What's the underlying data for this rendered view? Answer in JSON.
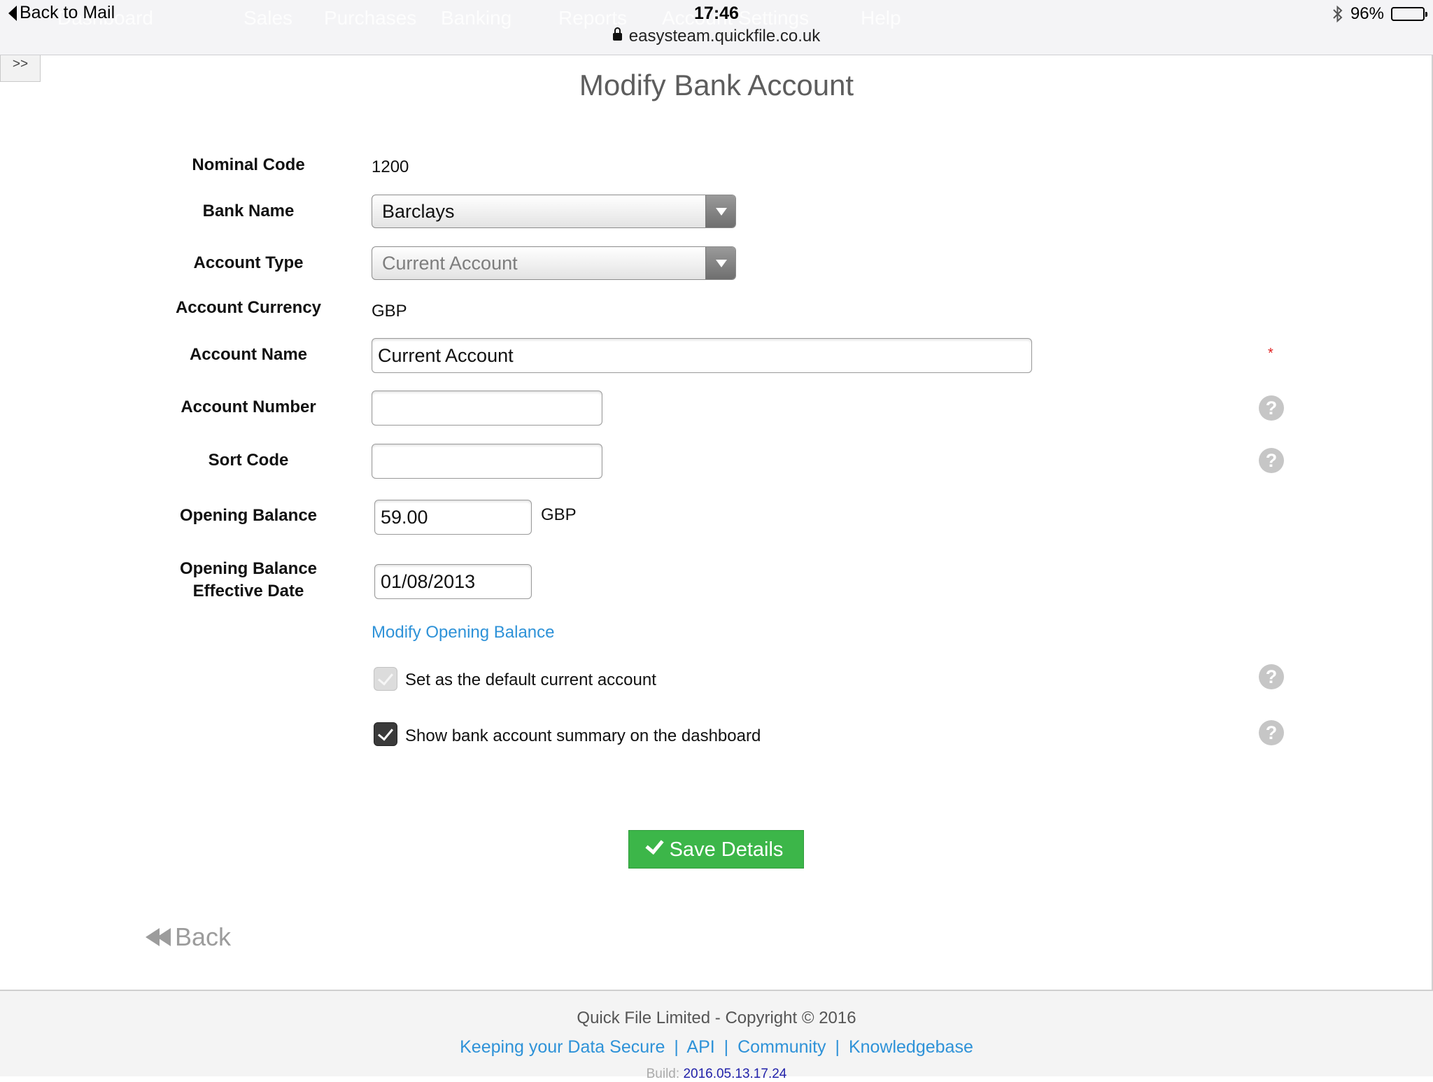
{
  "status_bar": {
    "back_label": "Back to Mail",
    "time": "17:46",
    "url": "easysteam.quickfile.co.uk",
    "battery": "96%",
    "battery_level": 0.96
  },
  "ghost_nav": [
    "Dashboard",
    "Sales",
    "Purchases",
    "Banking",
    "Reports",
    "Account Settings",
    "Help"
  ],
  "expand_label": ">>",
  "page": {
    "title": "Modify Bank Account"
  },
  "form": {
    "nominal_code_label": "Nominal Code",
    "nominal_code": "1200",
    "bank_name_label": "Bank Name",
    "bank_name": "Barclays",
    "account_type_label": "Account Type",
    "account_type": "Current Account",
    "account_currency_label": "Account Currency",
    "account_currency": "GBP",
    "account_name_label": "Account Name",
    "account_name": "Current Account",
    "required_mark": "*",
    "account_number_label": "Account Number",
    "account_number": "",
    "sort_code_label": "Sort Code",
    "sort_code": "",
    "opening_balance_label": "Opening Balance",
    "opening_balance": "59.00",
    "opening_balance_currency": "GBP",
    "opening_balance_date_label_1": "Opening Balance",
    "opening_balance_date_label_2": "Effective Date",
    "opening_balance_date": "01/08/2013",
    "modify_opening_balance_link": "Modify Opening Balance",
    "default_account_label": "Set as the default current account",
    "default_account_checked": true,
    "show_summary_label": "Show bank account summary on the dashboard",
    "show_summary_checked": true,
    "help_glyph": "?"
  },
  "actions": {
    "save_label": "Save Details",
    "back_label": "Back"
  },
  "footer": {
    "copyright": "Quick File Limited - Copyright © 2016",
    "links": [
      "Keeping your Data Secure",
      "API",
      "Community",
      "Knowledgebase"
    ],
    "separator": "|",
    "build_label": "Build:",
    "build_version": "2016.05.13.17.24"
  },
  "colors": {
    "accent_link": "#2e92d8",
    "save_button": "#3cb649",
    "required": "#e02020"
  }
}
